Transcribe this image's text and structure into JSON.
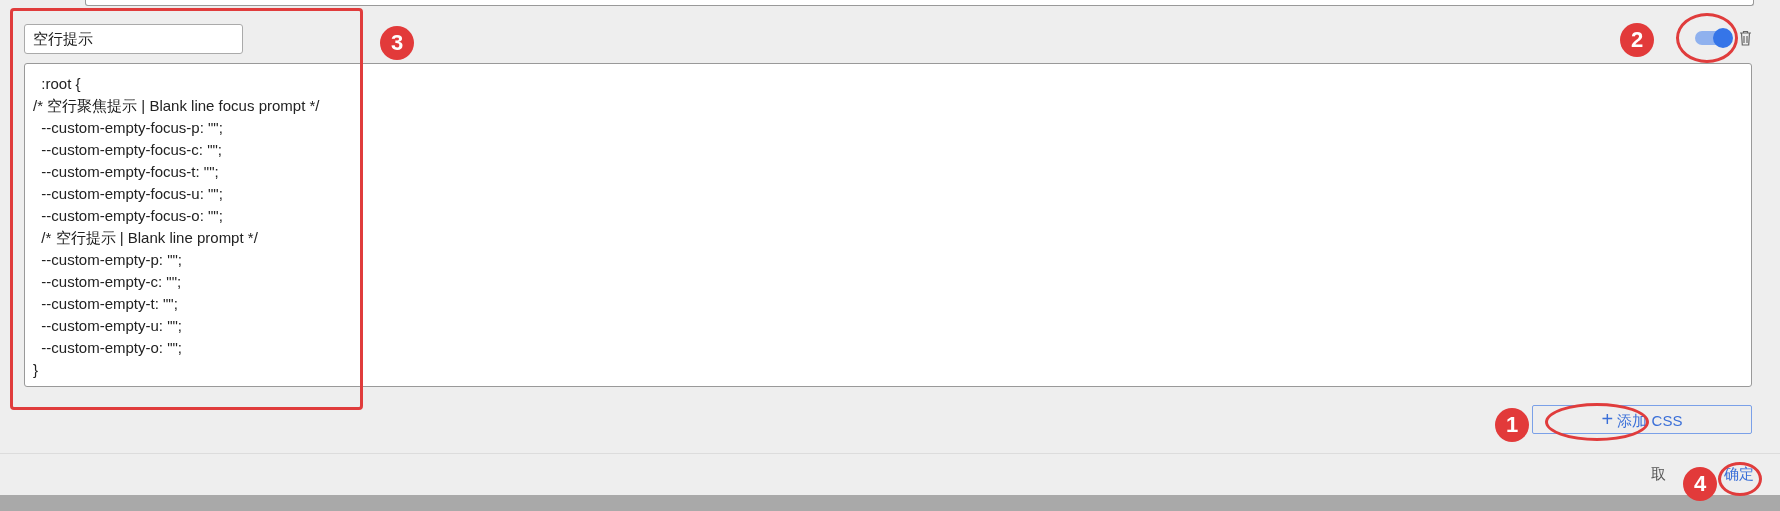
{
  "rule": {
    "name": "空行提示",
    "enabled": true,
    "css_lines": [
      "  :root {",
      "/* 空行聚焦提示 | Blank line focus prompt */",
      "  --custom-empty-focus-p: \"\";",
      "  --custom-empty-focus-c: \"\";",
      "  --custom-empty-focus-t: \"\";",
      "  --custom-empty-focus-u: \"\";",
      "  --custom-empty-focus-o: \"\";",
      "  /* 空行提示 | Blank line prompt */",
      "  --custom-empty-p: \"\";",
      "  --custom-empty-c: \"\";",
      "  --custom-empty-t: \"\";",
      "  --custom-empty-u: \"\";",
      "  --custom-empty-o: \"\";",
      "}"
    ]
  },
  "add_button": {
    "icon": "+",
    "label": "添加 CSS"
  },
  "footer": {
    "cancel": "取",
    "confirm": "确定"
  },
  "annotations": [
    {
      "label": "1"
    },
    {
      "label": "2"
    },
    {
      "label": "3"
    },
    {
      "label": "4"
    }
  ]
}
